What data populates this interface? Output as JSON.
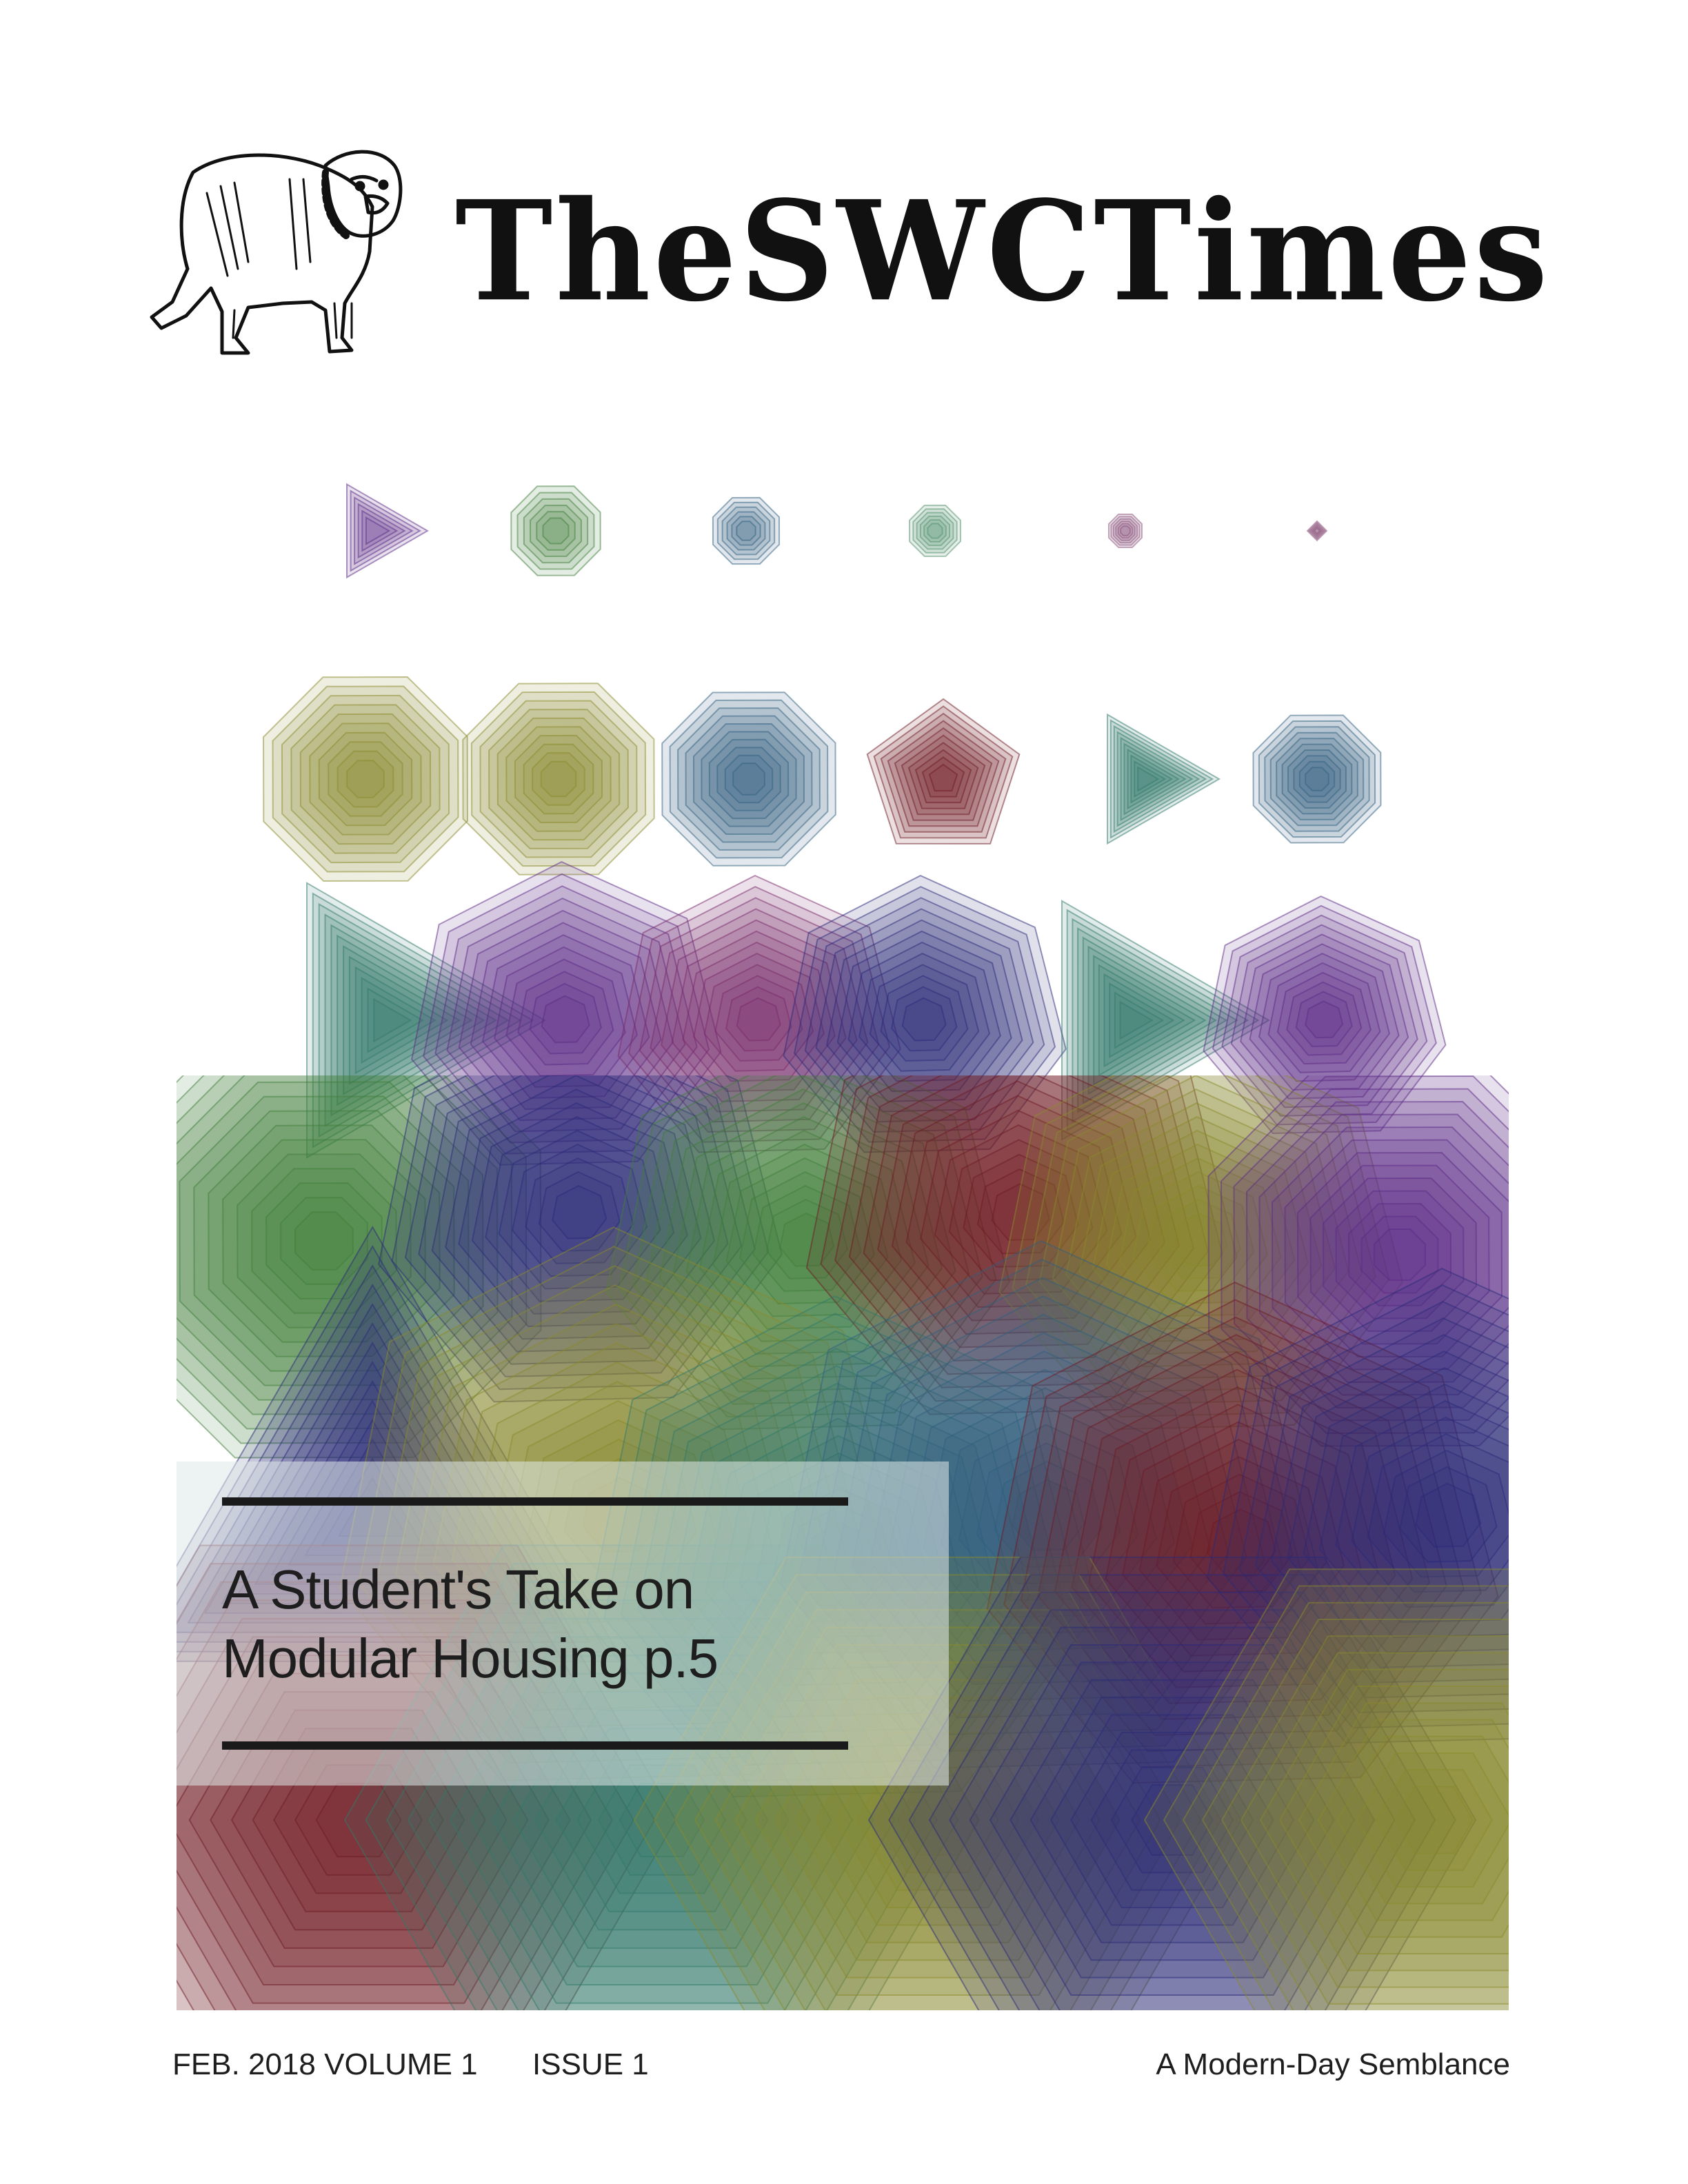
{
  "masthead": {
    "title_words": [
      "The",
      "SWC",
      "Times"
    ],
    "mascot": "bulldog-illustration"
  },
  "cover": {
    "headline_line1": "A Student's Take on",
    "headline_line2": "Modular Housing p.5"
  },
  "footer": {
    "issue_date": "FEB. 2018 VOLUME 1",
    "issue_number": "ISSUE 1",
    "tagline": "A Modern-Day Semblance"
  },
  "colors": {
    "purple": "#5b2a86",
    "green": "#3f7d3a",
    "olive": "#8a8a2a",
    "blue": "#2f5f80",
    "red": "#6e1a24",
    "teal": "#2f7a6a",
    "navy": "#2a2a7a",
    "magenta": "#7a2a6a",
    "sage": "#4f8f6a",
    "mauve": "#8a4f7a",
    "box": "#dde8e8",
    "ink": "#111111"
  }
}
